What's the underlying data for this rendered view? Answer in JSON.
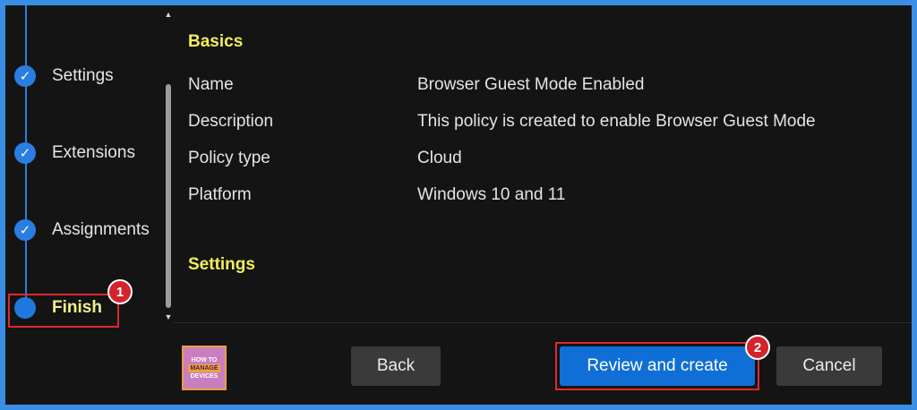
{
  "stepper": {
    "steps": [
      {
        "label": "Settings",
        "state": "done"
      },
      {
        "label": "Extensions",
        "state": "done"
      },
      {
        "label": "Assignments",
        "state": "done"
      },
      {
        "label": "Finish",
        "state": "current"
      }
    ]
  },
  "annotations": {
    "badge1": "1",
    "badge2": "2"
  },
  "review": {
    "basics_title": "Basics",
    "rows": [
      {
        "key": "Name",
        "value": "Browser Guest Mode Enabled"
      },
      {
        "key": "Description",
        "value": "This policy is created to enable Browser Guest Mode"
      },
      {
        "key": "Policy type",
        "value": "Cloud"
      },
      {
        "key": "Platform",
        "value": "Windows 10 and 11"
      }
    ],
    "settings_title": "Settings"
  },
  "logo": {
    "line1": "HOW TO",
    "line2": "MANAGE",
    "line3": "DEVICES"
  },
  "footer": {
    "back_label": "Back",
    "review_label": "Review and create",
    "cancel_label": "Cancel"
  },
  "colors": {
    "accent": "#0f6fd6",
    "highlight": "#f2ef5a",
    "annotation": "#e0282e"
  }
}
